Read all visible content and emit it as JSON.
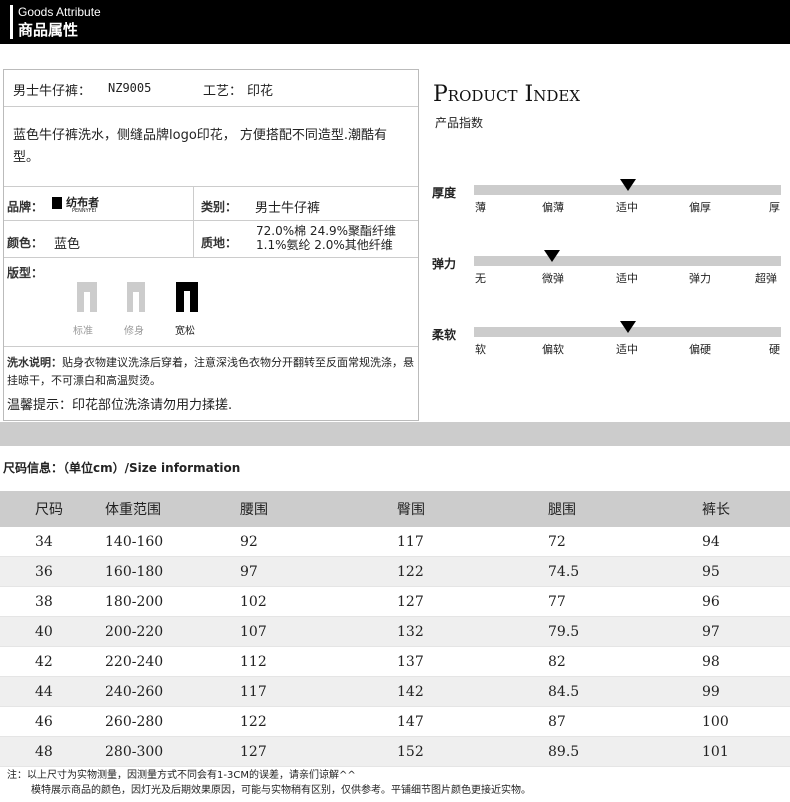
{
  "header": {
    "en": "Goods Attribute",
    "cn": "商品属性"
  },
  "info": {
    "name_label": "男士牛仔裤：",
    "name_value": "NZ9005",
    "craft_label": "工艺：",
    "craft_value": "印花",
    "description": "蓝色牛仔裤洗水，侧缝品牌logo印花， 方便搭配不同造型.潮酷有型。",
    "brand_label": "品牌：",
    "brand_logo_text": "纺布者",
    "brand_logo_sub": "PENNYFEI",
    "category_label": "类别：",
    "category_value": "男士牛仔裤",
    "color_label": "颜色：",
    "color_value": "蓝色",
    "material_label": "质地：",
    "material_line1": "72.0%棉 24.9%聚酯纤维",
    "material_line2": "1.1%氨纶 2.0%其他纤维",
    "fit_label": "版型：",
    "fits": [
      {
        "label": "标准",
        "color": "#cccccc",
        "selected": false
      },
      {
        "label": "修身",
        "color": "#cccccc",
        "selected": false
      },
      {
        "label": "宽松",
        "color": "#000000",
        "selected": true
      }
    ],
    "wash_label": "洗水说明：",
    "wash_text": "贴身衣物建议洗涤后穿着，注意深浅色衣物分开翻转至反面常规洗涤，悬挂晾干，不可漂白和高温熨烫。",
    "tip": "温馨提示：印花部位洗涤请勿用力揉搓."
  },
  "product_index": {
    "title": "Product Index",
    "subtitle": "产品指数",
    "scales": [
      {
        "name": "厚度",
        "labels": [
          "薄",
          "偏薄",
          "适中",
          "偏厚",
          "厚"
        ],
        "level": 0.5
      },
      {
        "name": "弹力",
        "labels": [
          "无",
          "微弹",
          "适中",
          "弹力",
          "超弹"
        ],
        "level": 0.25
      },
      {
        "name": "柔软",
        "labels": [
          "软",
          "偏软",
          "适中",
          "偏硬",
          "硬"
        ],
        "level": 0.5
      }
    ]
  },
  "size": {
    "title": "尺码信息：（单位cm）/Size information",
    "headers": [
      "尺码",
      "体重范围",
      "腰围",
      "臀围",
      "腿围",
      "裤长"
    ],
    "rows": [
      [
        "34",
        "140-160",
        "92",
        "117",
        "72",
        "94"
      ],
      [
        "36",
        "160-180",
        "97",
        "122",
        "74.5",
        "95"
      ],
      [
        "38",
        "180-200",
        "102",
        "127",
        "77",
        "96"
      ],
      [
        "40",
        "200-220",
        "107",
        "132",
        "79.5",
        "97"
      ],
      [
        "42",
        "220-240",
        "112",
        "137",
        "82",
        "98"
      ],
      [
        "44",
        "240-260",
        "117",
        "142",
        "84.5",
        "99"
      ],
      [
        "46",
        "260-280",
        "122",
        "147",
        "87",
        "100"
      ],
      [
        "48",
        "280-300",
        "127",
        "152",
        "89.5",
        "101"
      ]
    ]
  },
  "notes": [
    "注：以上尺寸为实物测量，因测量方式不同会有1-3CM的误差，请亲们谅解^^",
    "模特展示商品的颜色，因灯光及后期效果原因，可能与实物稍有区别，仅供参考。平铺细节图片颜色更接近实物。"
  ]
}
